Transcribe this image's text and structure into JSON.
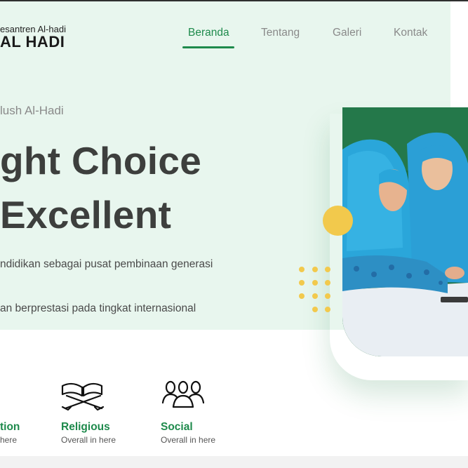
{
  "brand": {
    "tagline": "esantren Al-hadi",
    "name": "AL HADI"
  },
  "nav": {
    "items": [
      {
        "label": "Beranda",
        "active": true
      },
      {
        "label": "Tentang",
        "active": false
      },
      {
        "label": "Galeri",
        "active": false
      },
      {
        "label": "Kontak",
        "active": false
      }
    ]
  },
  "hero": {
    "eyebrow": "lush Al-Hadi",
    "headline_line1": "ght Choice",
    "headline_line2": "Excellent",
    "paragraph_line1": "ndidikan sebagai pusat pembinaan generasi",
    "paragraph_line2": "an berprestasi pada tingkat internasional"
  },
  "features": [
    {
      "title": "tion",
      "subtitle": "here",
      "icon": "education-icon"
    },
    {
      "title": "Religious",
      "subtitle": "Overall in here",
      "icon": "open-quran-icon"
    },
    {
      "title": "Social",
      "subtitle": "Overall in here",
      "icon": "community-icon"
    }
  ],
  "colors": {
    "accent": "#1e8a4c",
    "hero_bg": "#e8f6ee",
    "decor": "#f2c94c",
    "headline": "#3d3f3d"
  }
}
